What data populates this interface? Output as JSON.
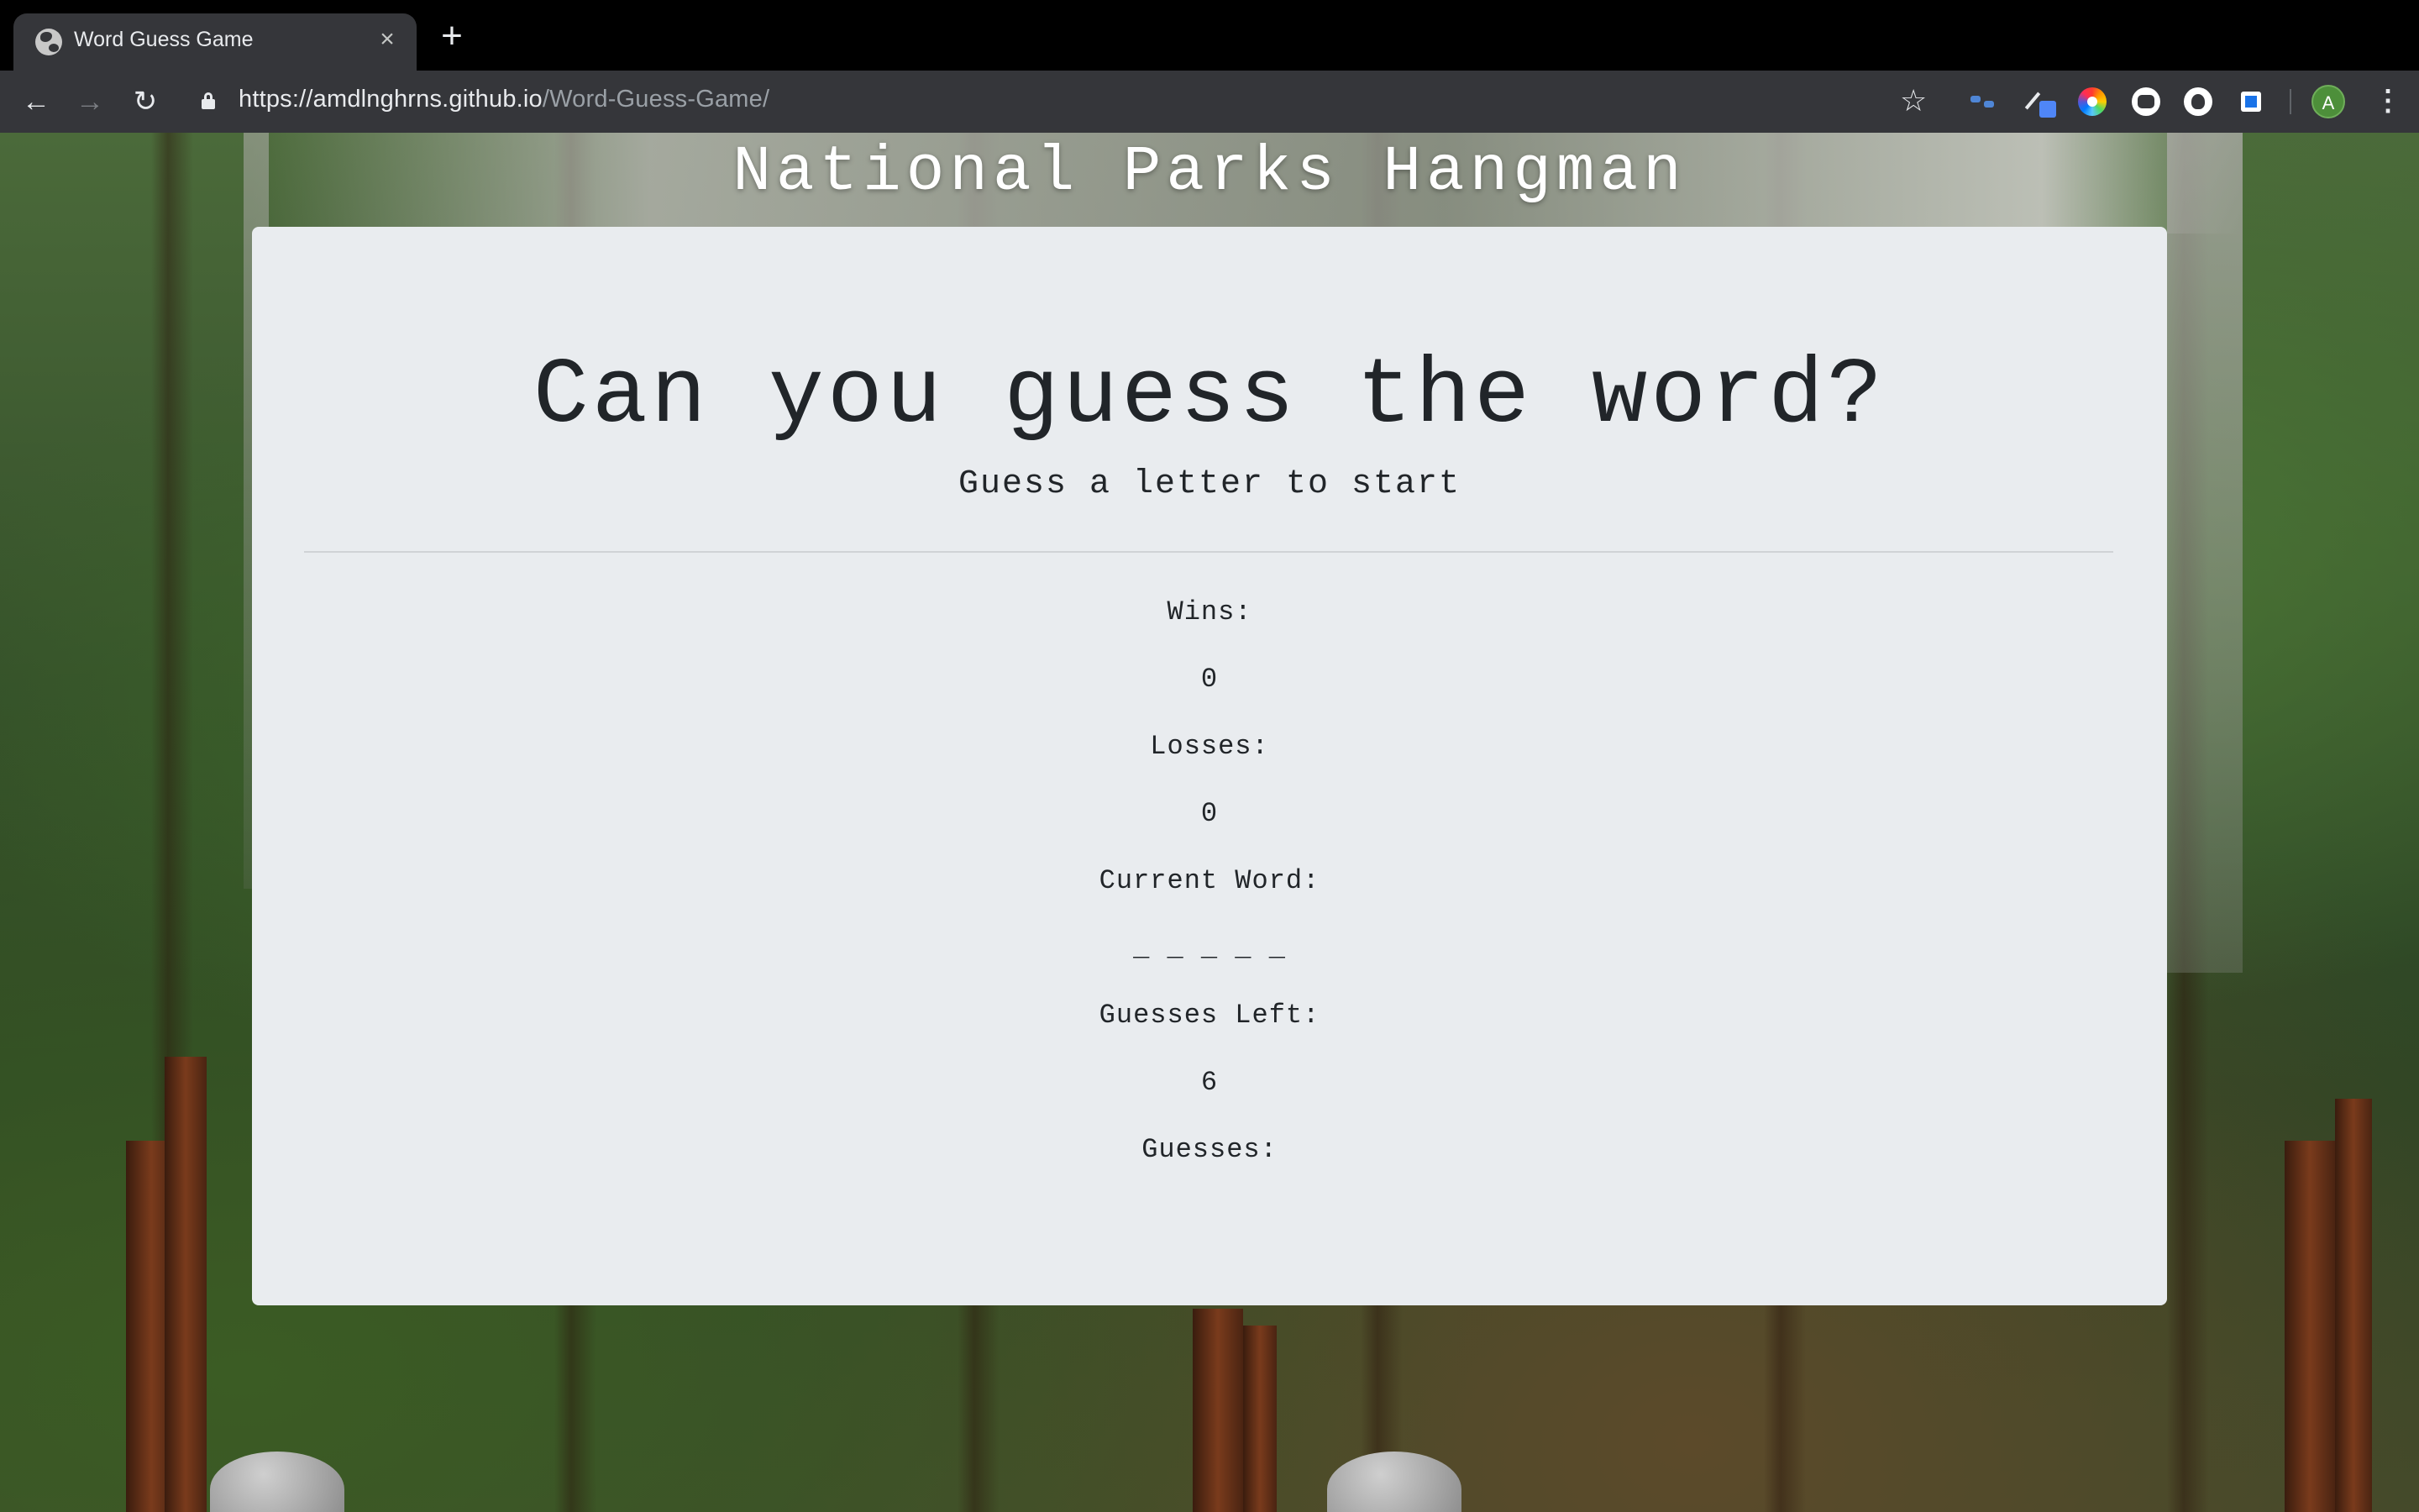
{
  "browser": {
    "tab_title": "Word Guess Game",
    "url_host": "https://amdlnghrns.github.io",
    "url_path": "/Word-Guess-Game/",
    "avatar_letter": "A"
  },
  "page": {
    "site_title": "National Parks Hangman",
    "heading": "Can you guess the word?",
    "subheading": "Guess a letter to start",
    "wins_label": "Wins:",
    "wins_value": "0",
    "losses_label": "Losses:",
    "losses_value": "0",
    "current_word_label": "Current Word:",
    "current_word_value": "_ _ _ _ _",
    "guesses_left_label": "Guesses Left:",
    "guesses_left_value": "6",
    "guesses_label": "Guesses:",
    "guesses_value": ""
  }
}
